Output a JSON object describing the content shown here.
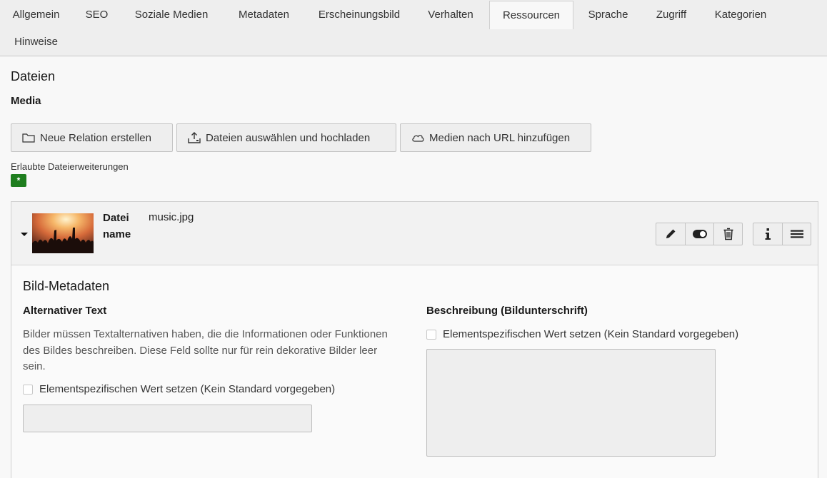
{
  "tabs": [
    {
      "label": "Allgemein"
    },
    {
      "label": "SEO"
    },
    {
      "label": "Soziale Medien"
    },
    {
      "label": "Metadaten"
    },
    {
      "label": "Erscheinungsbild"
    },
    {
      "label": "Verhalten"
    },
    {
      "label": "Ressourcen",
      "active": true
    },
    {
      "label": "Sprache"
    },
    {
      "label": "Zugriff"
    },
    {
      "label": "Kategorien"
    },
    {
      "label": "Hinweise"
    }
  ],
  "section": {
    "title": "Dateien",
    "field_label": "Media"
  },
  "buttons": {
    "new_relation": "Neue Relation erstellen",
    "upload": "Dateien auswählen und hochladen",
    "add_url": "Medien nach URL hinzufügen"
  },
  "allowed": {
    "label": "Erlaubte Dateierweiterungen",
    "badge": "*"
  },
  "file": {
    "meta_label": "Dateiname",
    "filename": "music.jpg",
    "icons": [
      "pencil-icon",
      "toggle-icon",
      "trash-icon",
      "info-icon",
      "drag-handle-icon"
    ]
  },
  "metadata": {
    "title": "Bild-Metadaten",
    "alt": {
      "label": "Alternativer Text",
      "help": "Bilder müssen Textalternativen haben, die die Informationen oder Funktionen des Bildes beschreiben. Diese Feld sollte nur für rein dekorative Bilder leer sein.",
      "checkbox_label": "Elementspezifischen Wert setzen (Kein Standard vorgegeben)",
      "value": ""
    },
    "description": {
      "label": "Beschreibung (Bildunterschrift)",
      "checkbox_label": "Elementspezifischen Wert setzen (Kein Standard vorgegeben)",
      "value": ""
    }
  },
  "colors": {
    "badge": "#1e7e1e",
    "tabbar": "#eeeeee",
    "page": "#f8f8f8"
  }
}
